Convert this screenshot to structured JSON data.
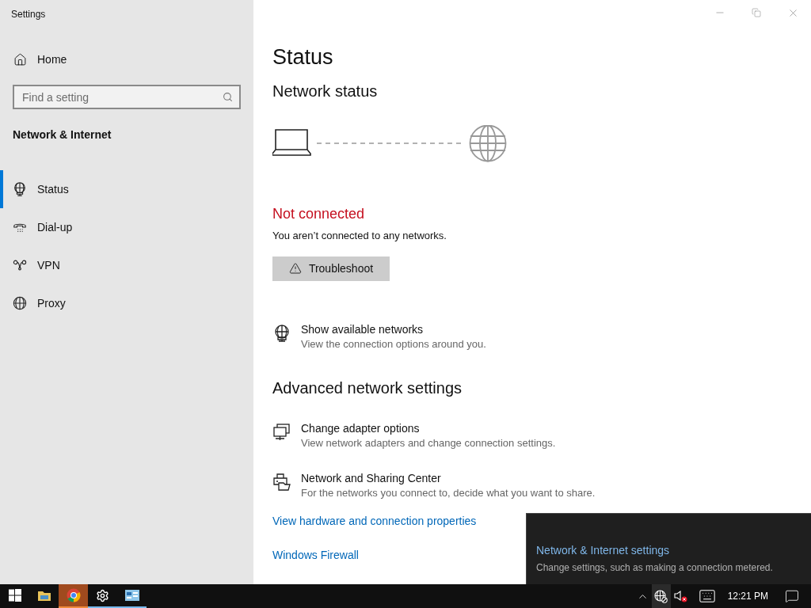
{
  "window": {
    "title": "Settings"
  },
  "sidebar": {
    "home": "Home",
    "search": {
      "placeholder": "Find a setting"
    },
    "section": "Network & Internet",
    "items": [
      {
        "label": "Status",
        "kind": "status",
        "selected": true
      },
      {
        "label": "Dial-up",
        "kind": "dialup",
        "selected": false
      },
      {
        "label": "VPN",
        "kind": "vpn",
        "selected": false
      },
      {
        "label": "Proxy",
        "kind": "proxy",
        "selected": false
      }
    ]
  },
  "page": {
    "title": "Status",
    "subtitle": "Network status",
    "status": {
      "title": "Not connected",
      "message": "You aren’t connected to any networks."
    },
    "troubleshoot_button": "Troubleshoot",
    "options": [
      {
        "kind": "networks",
        "title": "Show available networks",
        "description": "View the connection options around you."
      }
    ],
    "advanced": {
      "heading": "Advanced network settings",
      "items": [
        {
          "kind": "adapter",
          "title": "Change adapter options",
          "description": "View network adapters and change connection settings."
        },
        {
          "kind": "sharing",
          "title": "Network and Sharing Center",
          "description": "For the networks you connect to, decide what you want to share."
        }
      ],
      "links": [
        "View hardware and connection properties",
        "Windows Firewall"
      ]
    }
  },
  "flyout": {
    "title": "Network & Internet settings",
    "description": "Change settings, such as making a connection metered."
  },
  "taskbar": {
    "apps": [
      {
        "kind": "start",
        "selected": false,
        "running": false
      },
      {
        "kind": "explorer",
        "selected": false,
        "running": false
      },
      {
        "kind": "browser",
        "selected": true,
        "running": true
      },
      {
        "kind": "settings",
        "selected": false,
        "running": true
      },
      {
        "kind": "panel",
        "selected": false,
        "running": true
      }
    ],
    "clock": "12:21 PM"
  }
}
